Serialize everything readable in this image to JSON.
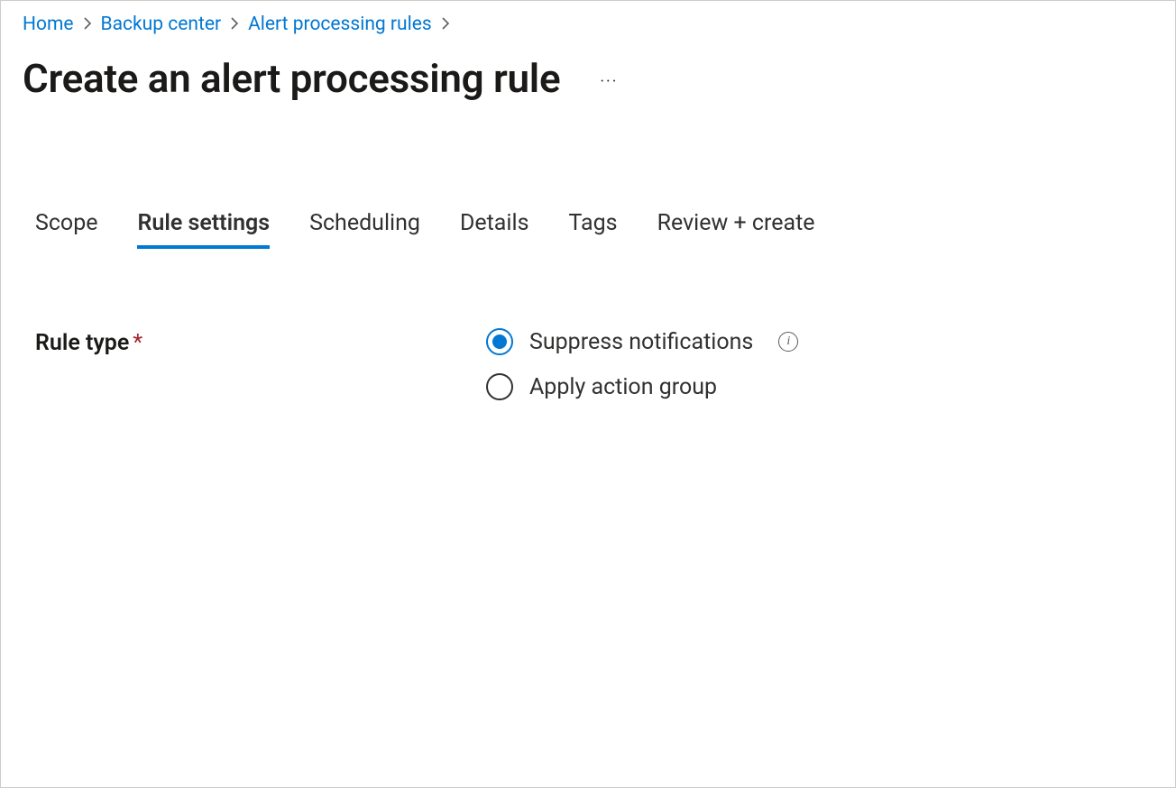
{
  "breadcrumb": {
    "items": [
      "Home",
      "Backup center",
      "Alert processing rules"
    ]
  },
  "header": {
    "title": "Create an alert processing rule",
    "more": "···"
  },
  "tabs": [
    {
      "label": "Scope",
      "active": false
    },
    {
      "label": "Rule settings",
      "active": true
    },
    {
      "label": "Scheduling",
      "active": false
    },
    {
      "label": "Details",
      "active": false
    },
    {
      "label": "Tags",
      "active": false
    },
    {
      "label": "Review + create",
      "active": false
    }
  ],
  "form": {
    "rule_type_label": "Rule type",
    "required_mark": "*",
    "options": [
      {
        "label": "Suppress notifications",
        "selected": true,
        "has_info": true
      },
      {
        "label": "Apply action group",
        "selected": false,
        "has_info": false
      }
    ],
    "info_glyph": "i"
  }
}
